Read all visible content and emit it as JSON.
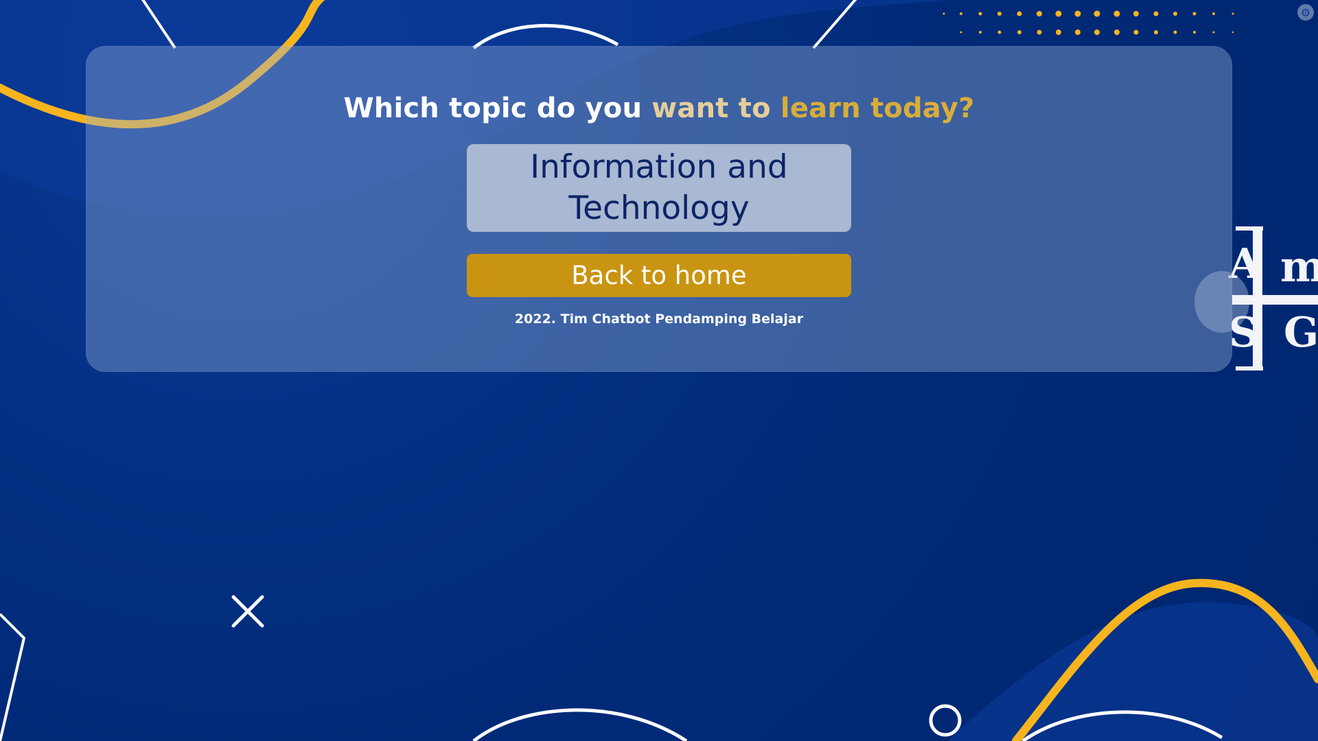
{
  "prompt": {
    "part_white": "Which topic do you",
    "part_accent1": "want to",
    "part_accent2": "learn today?"
  },
  "topics": [
    {
      "label": "Information and Technology"
    }
  ],
  "actions": {
    "back_home_label": "Back to home"
  },
  "footer": {
    "text": "2022. Tim Chatbot Pendamping Belajar"
  },
  "colors": {
    "background": "#002a78",
    "accent_gold": "#c99411",
    "accent_light_gold": "#e4cf9a",
    "topic_button_bg": "#a9b8d3",
    "topic_button_text": "#0b2466"
  },
  "icons": {
    "corner": "settings-icon",
    "decor_x": "close-x-decor-icon",
    "decor_circle": "circle-decor-icon",
    "logo": "university-logo"
  }
}
